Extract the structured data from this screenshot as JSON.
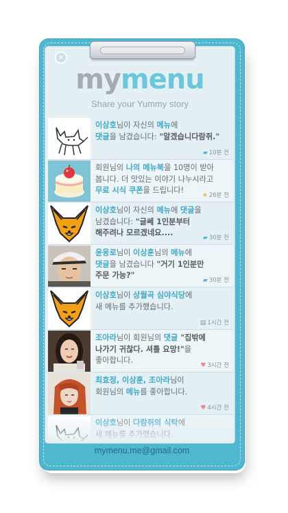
{
  "app": {
    "logo_my": "my",
    "logo_menu": "menu",
    "tagline": "Share your Yummy story",
    "close_icon": "close-icon",
    "footer_email": "mymenu.me@gmail.com"
  },
  "colors": {
    "frame": "#4fb7cf",
    "accent": "#3fa8c9",
    "paper": "#e4f0f4"
  },
  "feed": [
    {
      "avatar": "doodle-cat",
      "parts": [
        [
          "이상호",
          "hl"
        ],
        [
          "님이 자신의 ",
          ""
        ],
        [
          "메뉴",
          "hl"
        ],
        [
          "에",
          ""
        ],
        [
          "\n",
          ""
        ],
        [
          "댓글",
          "hl"
        ],
        [
          "을 남겼습니다: ",
          ""
        ],
        [
          "\"알겠습니다람쥐.\"",
          "quote"
        ]
      ],
      "icon": "comment-icon",
      "time": "10분 전"
    },
    {
      "avatar": "cake",
      "parts": [
        [
          "회원님의 ",
          ""
        ],
        [
          "나의 메뉴북",
          "hl"
        ],
        [
          "을 10명이 받아",
          ""
        ],
        [
          "\n",
          ""
        ],
        [
          "봅니다. 더 맛있는 이야기 나누시라고",
          ""
        ],
        [
          "\n",
          ""
        ],
        [
          "무료 시식 쿠폰",
          "hl"
        ],
        [
          "을 드립니다!",
          ""
        ]
      ],
      "icon": "star-icon",
      "time": "26분 전"
    },
    {
      "avatar": "fox",
      "parts": [
        [
          "이상호",
          "hl"
        ],
        [
          "님이 자신의 ",
          ""
        ],
        [
          "메뉴",
          "hl"
        ],
        [
          "에 ",
          ""
        ],
        [
          "댓글",
          "hl"
        ],
        [
          "을",
          ""
        ],
        [
          "\n",
          ""
        ],
        [
          "남겼습니다: ",
          ""
        ],
        [
          "\"글쎄 1인분부터",
          "quote"
        ],
        [
          "\n",
          ""
        ],
        [
          "해주려나 모르겠네요....",
          "quote"
        ]
      ],
      "icon": "comment-icon",
      "time": "30분 전"
    },
    {
      "avatar": "man-photo",
      "parts": [
        [
          "윤웅로",
          "hl"
        ],
        [
          "님이 ",
          ""
        ],
        [
          "이상훈",
          "hl"
        ],
        [
          "님의 ",
          ""
        ],
        [
          "메뉴",
          "hl"
        ],
        [
          "에",
          ""
        ],
        [
          "\n",
          ""
        ],
        [
          "댓글",
          "hl"
        ],
        [
          "을 남겼습니다  ",
          ""
        ],
        [
          "\"거기 1인분만",
          "quote"
        ],
        [
          "\n",
          ""
        ],
        [
          "주문 가능?\"",
          "quote"
        ]
      ],
      "icon": "comment-icon",
      "time": "30분 전"
    },
    {
      "avatar": "fox",
      "parts": [
        [
          "이상호",
          "hl"
        ],
        [
          "님이 ",
          ""
        ],
        [
          "상월곡 심야식당",
          "hl"
        ],
        [
          "에",
          ""
        ],
        [
          "\n",
          ""
        ],
        [
          "새 메뉴를 추가했습니다.",
          ""
        ]
      ],
      "icon": "note-icon",
      "time": "1시간 전"
    },
    {
      "avatar": "woman-photo",
      "parts": [
        [
          "조아라",
          "hl"
        ],
        [
          "님이 회원님의 ",
          ""
        ],
        [
          "댓글",
          "hl"
        ],
        [
          " \"집밖에",
          "quote"
        ],
        [
          "\n",
          ""
        ],
        [
          "나가기 귀찮다. 셔틀 요망!\"",
          "quote"
        ],
        [
          "을",
          ""
        ],
        [
          "\n",
          ""
        ],
        [
          "좋아합니다.",
          ""
        ]
      ],
      "icon": "heart-icon",
      "time": "3시간 전"
    },
    {
      "avatar": "girl-photo",
      "parts": [
        [
          "최효정, 이상훈, 조아라",
          "hl"
        ],
        [
          "님이",
          ""
        ],
        [
          "\n",
          ""
        ],
        [
          "회원님의 ",
          ""
        ],
        [
          "메뉴",
          "hl"
        ],
        [
          "를 좋아합니다.",
          ""
        ]
      ],
      "icon": "heart-icon",
      "time": "4시간 전"
    },
    {
      "avatar": "doodle-cat",
      "parts": [
        [
          "이상호",
          "hl"
        ],
        [
          "님이 ",
          ""
        ],
        [
          "다람쥐의 식탁",
          "hl"
        ],
        [
          "에",
          ""
        ],
        [
          "\n",
          ""
        ],
        [
          "새 메뉴를 추가했습니다.",
          ""
        ]
      ],
      "icon": "note-icon",
      "time": ""
    }
  ]
}
